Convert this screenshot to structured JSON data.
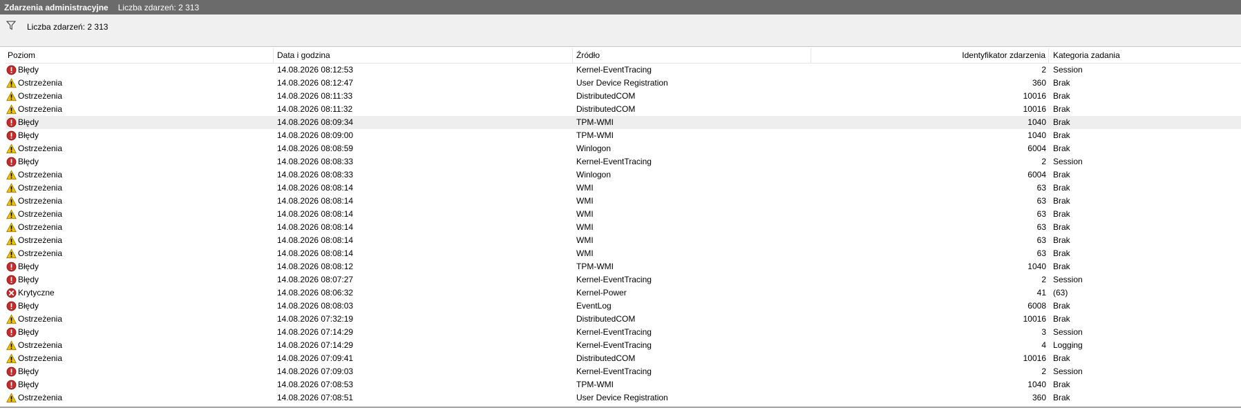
{
  "titlebar": {
    "title": "Zdarzenia administracyjne",
    "count": "Liczba zdarzeń: 2 313"
  },
  "filterbar": {
    "icon": "filter-icon",
    "text": "Liczba zdarzeń: 2 313"
  },
  "columns": {
    "level": "Poziom",
    "date": "Data i godzina",
    "source": "Źródło",
    "id": "Identyfikator zdarzenia",
    "category": "Kategoria zadania"
  },
  "colors": {
    "error": "#c42b2b",
    "warning": "#f2c200",
    "critical": "#c42b2b",
    "selected_row": "#eeeeee"
  },
  "selected_index": 4,
  "rows": [
    {
      "type": "error",
      "level": "Błędy",
      "date": "14.08.2026 08:12:53",
      "source": "Kernel-EventTracing",
      "id": "2",
      "category": "Session"
    },
    {
      "type": "warning",
      "level": "Ostrzeżenia",
      "date": "14.08.2026 08:12:47",
      "source": "User Device Registration",
      "id": "360",
      "category": "Brak"
    },
    {
      "type": "warning",
      "level": "Ostrzeżenia",
      "date": "14.08.2026 08:11:33",
      "source": "DistributedCOM",
      "id": "10016",
      "category": "Brak"
    },
    {
      "type": "warning",
      "level": "Ostrzeżenia",
      "date": "14.08.2026 08:11:32",
      "source": "DistributedCOM",
      "id": "10016",
      "category": "Brak"
    },
    {
      "type": "error",
      "level": "Błędy",
      "date": "14.08.2026 08:09:34",
      "source": "TPM-WMI",
      "id": "1040",
      "category": "Brak"
    },
    {
      "type": "error",
      "level": "Błędy",
      "date": "14.08.2026 08:09:00",
      "source": "TPM-WMI",
      "id": "1040",
      "category": "Brak"
    },
    {
      "type": "warning",
      "level": "Ostrzeżenia",
      "date": "14.08.2026 08:08:59",
      "source": "Winlogon",
      "id": "6004",
      "category": "Brak"
    },
    {
      "type": "error",
      "level": "Błędy",
      "date": "14.08.2026 08:08:33",
      "source": "Kernel-EventTracing",
      "id": "2",
      "category": "Session"
    },
    {
      "type": "warning",
      "level": "Ostrzeżenia",
      "date": "14.08.2026 08:08:33",
      "source": "Winlogon",
      "id": "6004",
      "category": "Brak"
    },
    {
      "type": "warning",
      "level": "Ostrzeżenia",
      "date": "14.08.2026 08:08:14",
      "source": "WMI",
      "id": "63",
      "category": "Brak"
    },
    {
      "type": "warning",
      "level": "Ostrzeżenia",
      "date": "14.08.2026 08:08:14",
      "source": "WMI",
      "id": "63",
      "category": "Brak"
    },
    {
      "type": "warning",
      "level": "Ostrzeżenia",
      "date": "14.08.2026 08:08:14",
      "source": "WMI",
      "id": "63",
      "category": "Brak"
    },
    {
      "type": "warning",
      "level": "Ostrzeżenia",
      "date": "14.08.2026 08:08:14",
      "source": "WMI",
      "id": "63",
      "category": "Brak"
    },
    {
      "type": "warning",
      "level": "Ostrzeżenia",
      "date": "14.08.2026 08:08:14",
      "source": "WMI",
      "id": "63",
      "category": "Brak"
    },
    {
      "type": "warning",
      "level": "Ostrzeżenia",
      "date": "14.08.2026 08:08:14",
      "source": "WMI",
      "id": "63",
      "category": "Brak"
    },
    {
      "type": "error",
      "level": "Błędy",
      "date": "14.08.2026 08:08:12",
      "source": "TPM-WMI",
      "id": "1040",
      "category": "Brak"
    },
    {
      "type": "error",
      "level": "Błędy",
      "date": "14.08.2026 08:07:27",
      "source": "Kernel-EventTracing",
      "id": "2",
      "category": "Session"
    },
    {
      "type": "critical",
      "level": "Krytyczne",
      "date": "14.08.2026 08:06:32",
      "source": "Kernel-Power",
      "id": "41",
      "category": "(63)"
    },
    {
      "type": "error",
      "level": "Błędy",
      "date": "14.08.2026 08:08:03",
      "source": "EventLog",
      "id": "6008",
      "category": "Brak"
    },
    {
      "type": "warning",
      "level": "Ostrzeżenia",
      "date": "14.08.2026 07:32:19",
      "source": "DistributedCOM",
      "id": "10016",
      "category": "Brak"
    },
    {
      "type": "error",
      "level": "Błędy",
      "date": "14.08.2026 07:14:29",
      "source": "Kernel-EventTracing",
      "id": "3",
      "category": "Session"
    },
    {
      "type": "warning",
      "level": "Ostrzeżenia",
      "date": "14.08.2026 07:14:29",
      "source": "Kernel-EventTracing",
      "id": "4",
      "category": "Logging"
    },
    {
      "type": "warning",
      "level": "Ostrzeżenia",
      "date": "14.08.2026 07:09:41",
      "source": "DistributedCOM",
      "id": "10016",
      "category": "Brak"
    },
    {
      "type": "error",
      "level": "Błędy",
      "date": "14.08.2026 07:09:03",
      "source": "Kernel-EventTracing",
      "id": "2",
      "category": "Session"
    },
    {
      "type": "error",
      "level": "Błędy",
      "date": "14.08.2026 07:08:53",
      "source": "TPM-WMI",
      "id": "1040",
      "category": "Brak"
    },
    {
      "type": "warning",
      "level": "Ostrzeżenia",
      "date": "14.08.2026 07:08:51",
      "source": "User Device Registration",
      "id": "360",
      "category": "Brak"
    }
  ]
}
